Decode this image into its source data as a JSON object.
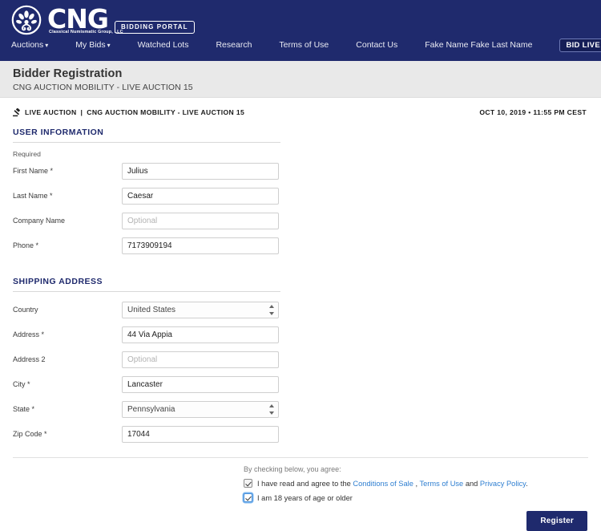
{
  "brand": {
    "logo_main": "CNG",
    "logo_sub": "Classical Numismatic Group, LLC",
    "badge": "BIDDING PORTAL",
    "navy": "#1f2a6d",
    "link_blue": "#2f7fd1"
  },
  "nav": {
    "items": [
      {
        "label": "Auctions",
        "caret": "▾"
      },
      {
        "label": "My Bids",
        "caret": "▾"
      },
      {
        "label": "Watched Lots",
        "caret": ""
      },
      {
        "label": "Research",
        "caret": ""
      },
      {
        "label": "Terms of Use",
        "caret": ""
      },
      {
        "label": "Contact Us",
        "caret": ""
      },
      {
        "label": "Fake Name Fake Last Name",
        "caret": ""
      }
    ],
    "bid_live": "BID LIVE",
    "search_icon": "search-icon"
  },
  "page_header": {
    "title": "Bidder Registration",
    "subtitle": "CNG AUCTION MOBILITY  - LIVE AUCTION 15"
  },
  "breadcrumb": {
    "icon": "gavel-icon",
    "live_label": "LIVE AUCTION",
    "separator": "|",
    "auction_name": "CNG AUCTION MOBILITY - LIVE AUCTION 15",
    "datetime": "OCT 10, 2019 • 11:55 PM CEST"
  },
  "user_information": {
    "heading": "USER INFORMATION",
    "required_note": "Required",
    "fields": [
      {
        "label": "First Name *",
        "value": "Julius",
        "placeholder": "",
        "type": "text"
      },
      {
        "label": "Last Name *",
        "value": "Caesar",
        "placeholder": "",
        "type": "text"
      },
      {
        "label": "Company Name",
        "value": "",
        "placeholder": "Optional",
        "type": "text"
      },
      {
        "label": "Phone *",
        "value": "7173909194",
        "placeholder": "",
        "type": "text"
      }
    ]
  },
  "shipping_address": {
    "heading": "SHIPPING ADDRESS",
    "country": {
      "label": "Country",
      "value": "United States"
    },
    "address1": {
      "label": "Address *",
      "value": "44 Via Appia",
      "placeholder": ""
    },
    "address2": {
      "label": "Address 2",
      "value": "",
      "placeholder": "Optional"
    },
    "city": {
      "label": "City *",
      "value": "Lancaster",
      "placeholder": ""
    },
    "state": {
      "label": "State *",
      "value": "Pennsylvania"
    },
    "zip": {
      "label": "Zip Code *",
      "value": "17044",
      "placeholder": ""
    }
  },
  "agreement": {
    "intro": "By checking below, you agree:",
    "line1_prefix": "I have read and agree to the ",
    "link_conditions": "Conditions of Sale",
    "line1_mid1": " , ",
    "link_terms": "Terms of Use",
    "line1_mid2": " and ",
    "link_privacy": "Privacy Policy",
    "line1_suffix": ".",
    "line2": "I am 18 years of age or older",
    "checkbox1_checked": true,
    "checkbox2_checked": true
  },
  "actions": {
    "register": "Register"
  }
}
